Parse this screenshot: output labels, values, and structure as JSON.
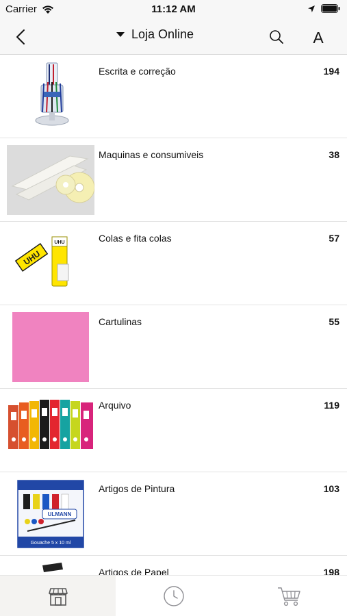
{
  "status_bar": {
    "carrier": "Carrier",
    "time": "11:12 AM"
  },
  "nav": {
    "title": "Loja Online",
    "font_button_label": "A"
  },
  "categories": [
    {
      "label": "Escrita e correção",
      "count": "194",
      "icon": "pen-display-stand-image"
    },
    {
      "label": "Maquinas e consumiveis",
      "count": "38",
      "icon": "paper-rolls-image"
    },
    {
      "label": "Colas e fita colas",
      "count": "57",
      "icon": "uhu-glue-sticks-image"
    },
    {
      "label": "Cartulinas",
      "count": "55",
      "icon": "pink-card-image"
    },
    {
      "label": "Arquivo",
      "count": "119",
      "icon": "colored-binders-image"
    },
    {
      "label": "Artigos de Pintura",
      "count": "103",
      "icon": "gouache-paint-set-image"
    },
    {
      "label": "Artigos de Papel",
      "count": "198",
      "icon": "paper-item-image"
    }
  ],
  "thumb_texts": {
    "uhu": "UHU",
    "ulmann": "ULMANN",
    "gouache": "Gouache 5 x 10 ml"
  },
  "tabs": [
    {
      "name": "shop",
      "icon": "storefront-icon",
      "active": true
    },
    {
      "name": "history",
      "icon": "clock-icon",
      "active": false
    },
    {
      "name": "cart",
      "icon": "cart-icon",
      "active": false
    }
  ],
  "colors": {
    "card_pink": "#f083c0",
    "bar_bg": "#f7f7f7",
    "active_tab_bg": "#f4f3f1",
    "icon_gray": "#8e8e93"
  }
}
